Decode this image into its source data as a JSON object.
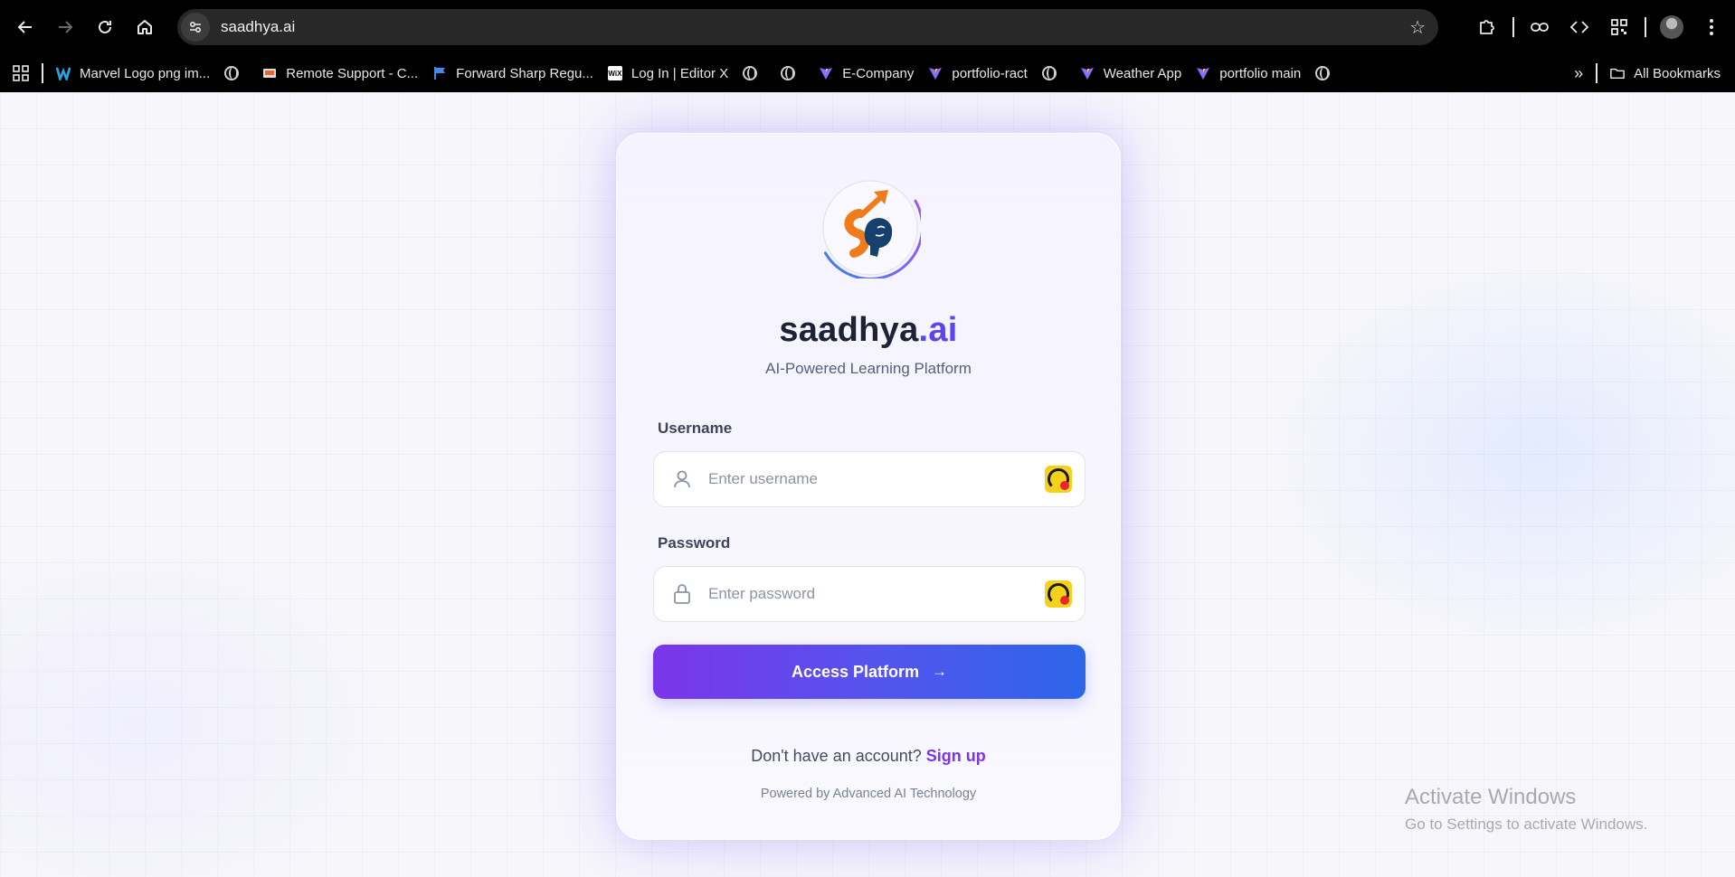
{
  "browser": {
    "url": "saadhya.ai",
    "bookmarks": [
      {
        "label": "Marvel Logo png im...",
        "icon": "marvel-icon"
      },
      {
        "label": "",
        "icon": "globe-icon"
      },
      {
        "label": "Remote Support - C...",
        "icon": "remote-support-icon"
      },
      {
        "label": "Forward Sharp Regu...",
        "icon": "flag-icon"
      },
      {
        "label": "Log In | Editor X",
        "icon": "wix-icon"
      },
      {
        "label": "",
        "icon": "globe-icon"
      },
      {
        "label": "",
        "icon": "globe-icon"
      },
      {
        "label": "E-Company",
        "icon": "vite-icon"
      },
      {
        "label": "portfolio-ract",
        "icon": "vite-icon"
      },
      {
        "label": "",
        "icon": "globe-icon"
      },
      {
        "label": "Weather App",
        "icon": "vite-icon"
      },
      {
        "label": "portfolio main",
        "icon": "vite-icon"
      },
      {
        "label": "",
        "icon": "globe-icon"
      }
    ],
    "all_bookmarks_label": "All Bookmarks",
    "wix_badge": "WiX"
  },
  "login": {
    "brand_main": "saadhya",
    "brand_suffix": ".ai",
    "tagline": "AI-Powered Learning Platform",
    "username_label": "Username",
    "username_placeholder": "Enter username",
    "password_label": "Password",
    "password_placeholder": "Enter password",
    "submit_label": "Access Platform",
    "signup_prompt": "Don't have an account?",
    "signup_link": "Sign up",
    "powered_by": "Powered by Advanced AI Technology"
  },
  "colors": {
    "brand_accent": "#5b45ef",
    "button_gradient_start": "#7b35ea",
    "button_gradient_end": "#2d66ea",
    "signup_link": "#7b35ea",
    "logo_orange": "#f07b1a",
    "logo_navy": "#16406e"
  },
  "watermark": {
    "title": "Activate Windows",
    "subtitle": "Go to Settings to activate Windows."
  }
}
